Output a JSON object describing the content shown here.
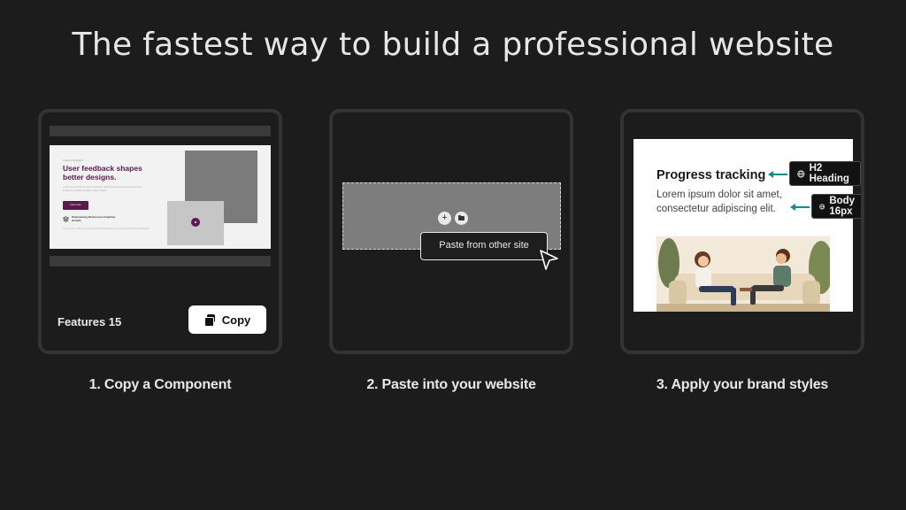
{
  "headline": "The fastest way to build a professional website",
  "step1": {
    "caption": "1. Copy a Component",
    "component_name": "Features 15",
    "copy_label": "Copy",
    "preview": {
      "eyebrow": "Feature Highlight",
      "title": "User feedback shapes better designs.",
      "body": "Lorem ipsum dolor sit amet consectetur adipiscing elit sed do eiusmod tempor incididunt ut labore et dolore magna aliqua.",
      "button": "Learn more",
      "feature": "Empowering Businesses Inspiring Growth",
      "footer": "Lorem ipsum dolor sit amet consectetur adipiscing elit sed do eiusmod tempor incididunt."
    }
  },
  "step2": {
    "caption": "2. Paste into your website",
    "paste_label": "Paste from other site",
    "plus_glyph": "+"
  },
  "step3": {
    "caption": "3. Apply your brand styles",
    "heading": "Progress tracking",
    "body": "Lorem ipsum dolor sit amet, consectetur adipiscing elit.",
    "tag_h2": "H2 Heading",
    "tag_body": "Body 16px",
    "accent_color": "#1a8a8a"
  },
  "colors": {
    "background": "#1c1c1c",
    "card_border": "#333333",
    "brand_purple": "#5a1a4e"
  }
}
